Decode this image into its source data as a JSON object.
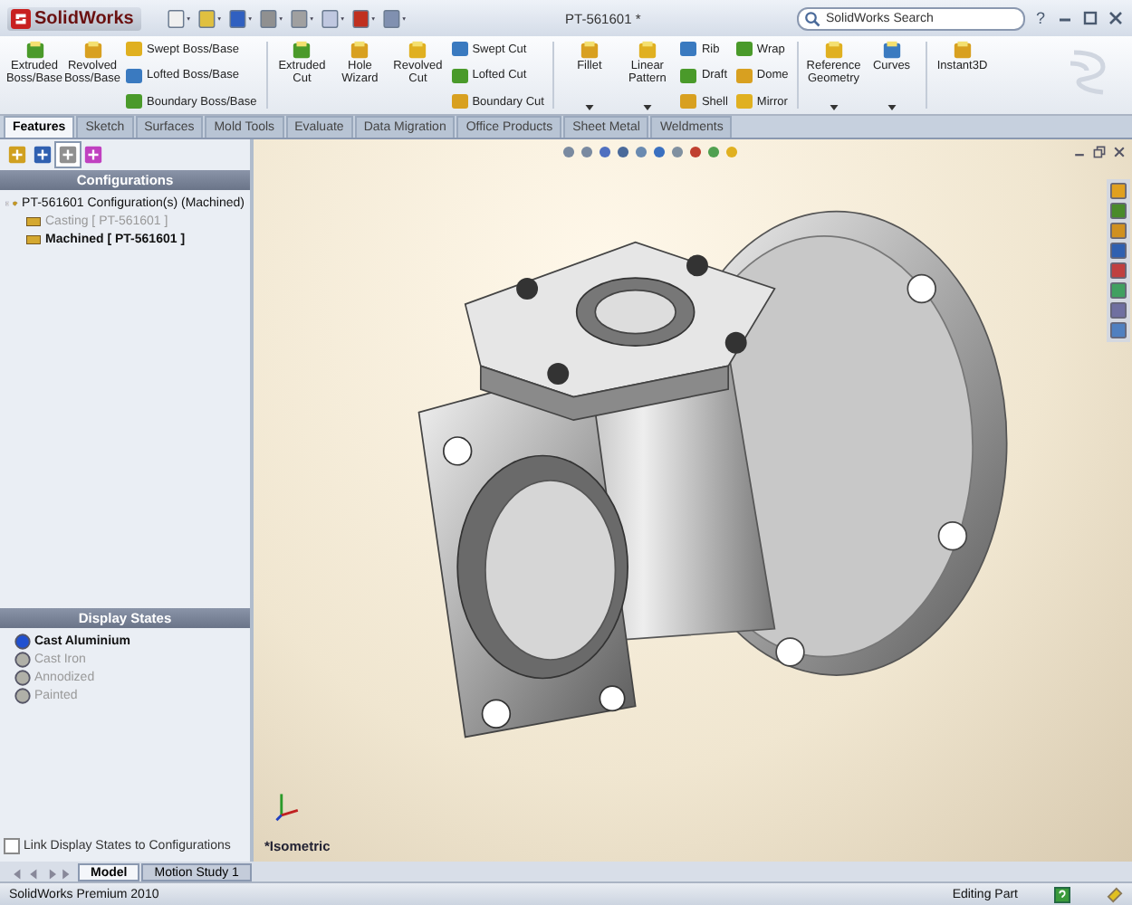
{
  "window": {
    "app_name": "SolidWorks",
    "title": "PT-561601 *",
    "search": {
      "placeholder": "SolidWorks Search"
    },
    "help": "?"
  },
  "ribbon": {
    "groups": [
      {
        "kind": "big",
        "label": "Extruded Boss/Base"
      },
      {
        "kind": "big",
        "label": "Revolved Boss/Base"
      },
      {
        "kind": "stack",
        "items": [
          {
            "label": "Swept Boss/Base"
          },
          {
            "label": "Lofted Boss/Base"
          },
          {
            "label": "Boundary Boss/Base"
          }
        ]
      },
      {
        "kind": "sep"
      },
      {
        "kind": "big",
        "label": "Extruded Cut"
      },
      {
        "kind": "big",
        "label": "Hole Wizard"
      },
      {
        "kind": "big",
        "label": "Revolved Cut"
      },
      {
        "kind": "stack",
        "items": [
          {
            "label": "Swept Cut"
          },
          {
            "label": "Lofted Cut"
          },
          {
            "label": "Boundary Cut"
          }
        ]
      },
      {
        "kind": "sep"
      },
      {
        "kind": "big",
        "label": "Fillet",
        "dropdown": true
      },
      {
        "kind": "big",
        "label": "Linear Pattern",
        "dropdown": true
      },
      {
        "kind": "stack",
        "items": [
          {
            "label": "Rib"
          },
          {
            "label": "Draft"
          },
          {
            "label": "Shell"
          }
        ]
      },
      {
        "kind": "stack",
        "items": [
          {
            "label": "Wrap"
          },
          {
            "label": "Dome"
          },
          {
            "label": "Mirror"
          }
        ]
      },
      {
        "kind": "sep"
      },
      {
        "kind": "big",
        "label": "Reference Geometry",
        "dropdown": true
      },
      {
        "kind": "big",
        "label": "Curves",
        "dropdown": true
      },
      {
        "kind": "sep"
      },
      {
        "kind": "big",
        "label": "Instant3D"
      }
    ]
  },
  "tabs": [
    {
      "label": "Features",
      "selected": true
    },
    {
      "label": "Sketch",
      "selected": false
    },
    {
      "label": "Surfaces",
      "selected": false
    },
    {
      "label": "Mold Tools",
      "selected": false
    },
    {
      "label": "Evaluate",
      "selected": false
    },
    {
      "label": "Data Migration",
      "selected": false
    },
    {
      "label": "Office Products",
      "selected": false
    },
    {
      "label": "Sheet Metal",
      "selected": false
    },
    {
      "label": "Weldments",
      "selected": false
    }
  ],
  "configurations": {
    "title": "Configurations",
    "tree": [
      {
        "label": "PT-561601 Configuration(s)  (Machined)",
        "expanded": true,
        "active": true,
        "children": [
          {
            "label": "Casting [ PT-561601 ]",
            "active": false
          },
          {
            "label": "Machined [ PT-561601 ]",
            "active": true
          }
        ]
      }
    ]
  },
  "display_states": {
    "title": "Display States",
    "items": [
      {
        "label": "Cast Aluminium",
        "selected": true
      },
      {
        "label": "Cast Iron",
        "selected": false
      },
      {
        "label": "Annodized",
        "selected": false
      },
      {
        "label": "Painted",
        "selected": false
      }
    ]
  },
  "link_option": {
    "label": "Link Display States to Configurations",
    "checked": false
  },
  "viewport": {
    "view_label": "*Isometric"
  },
  "bottom_tabs": [
    {
      "label": "Model",
      "selected": true
    },
    {
      "label": "Motion Study 1",
      "selected": false
    }
  ],
  "status_bar": {
    "product": "SolidWorks Premium 2010",
    "mode": "Editing Part"
  }
}
